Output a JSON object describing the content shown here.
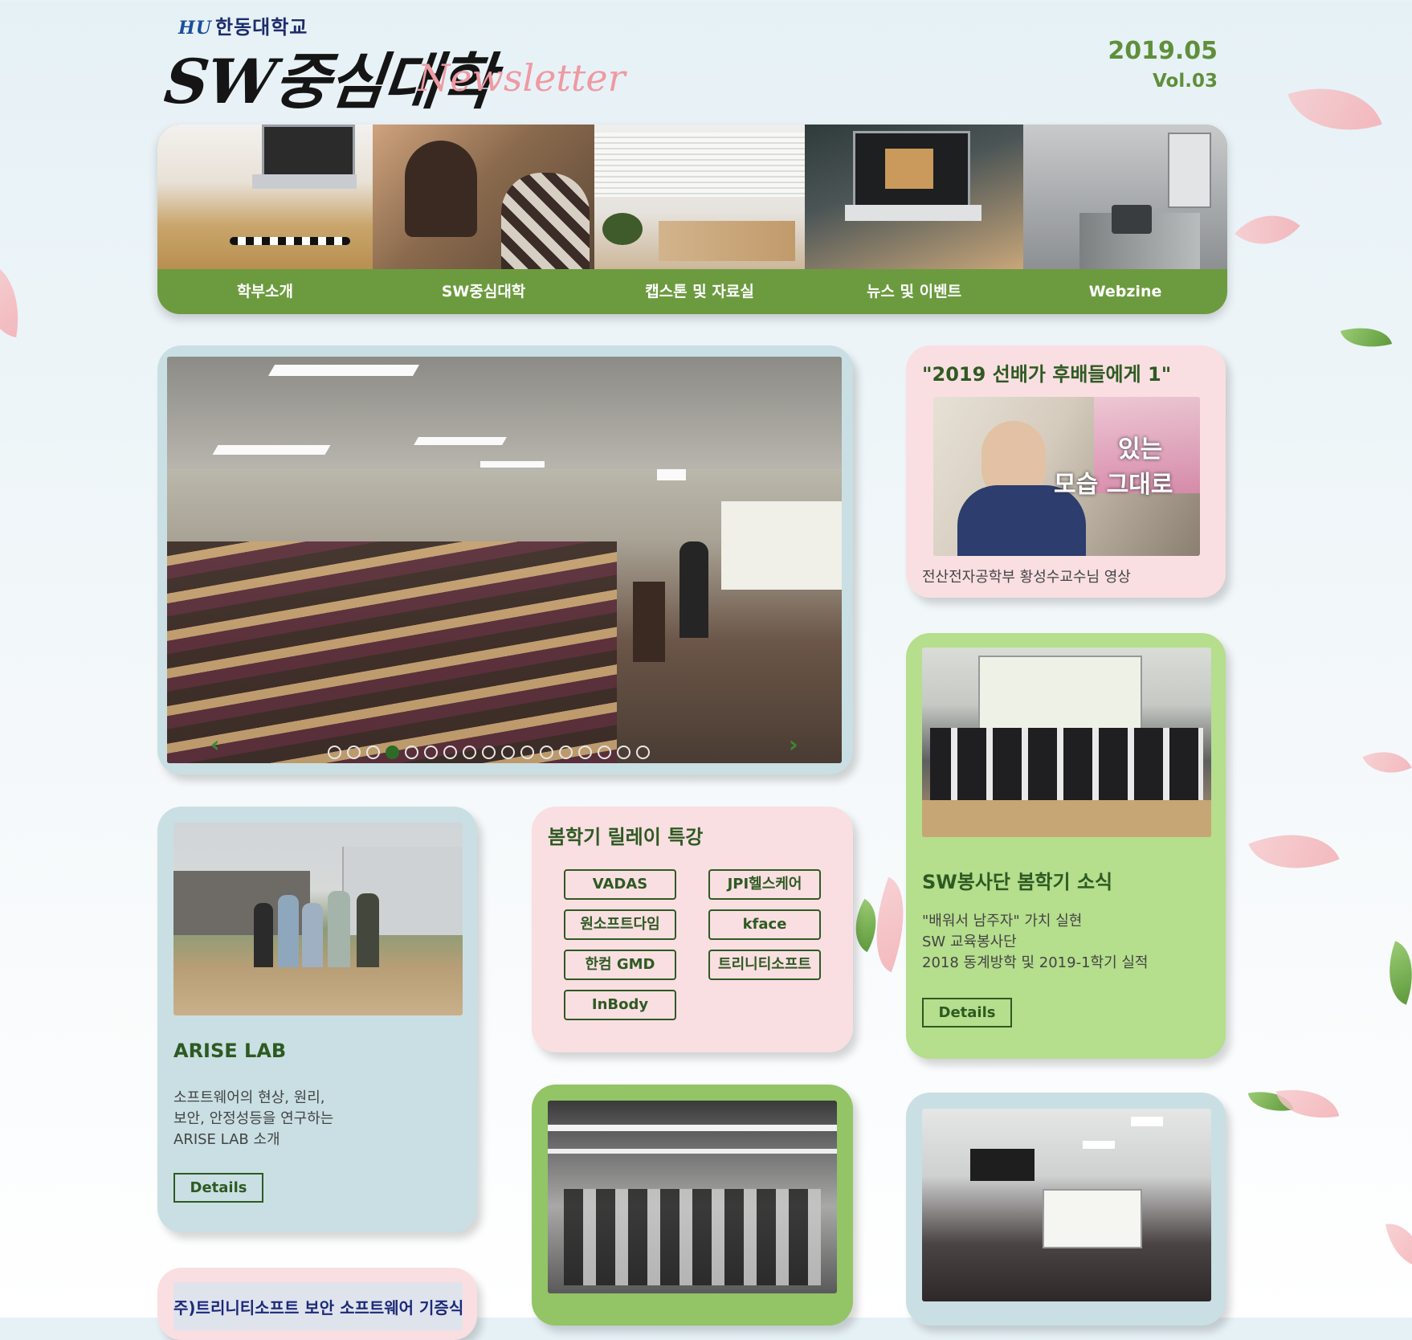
{
  "header": {
    "university": "한동대학교",
    "university_mark": "HU",
    "logo": "SW중심대학",
    "newsletter": "Newsletter",
    "date": "2019.05",
    "volume": "Vol.03"
  },
  "nav": {
    "items": [
      {
        "label": "학부소개"
      },
      {
        "label": "SW중심대학"
      },
      {
        "label": "캡스톤 및 자료실"
      },
      {
        "label": "뉴스 및 이벤트"
      },
      {
        "label": "Webzine"
      }
    ]
  },
  "slider": {
    "prev": "‹",
    "next": "›",
    "dot_count": 17,
    "active_dot": 4
  },
  "senior": {
    "title": "\"2019 선배가 후배들에게 1\"",
    "caption": "전산전자공학부 황성수교수님 영상",
    "overlay_line1": "있는",
    "overlay_line2": "모습 그대로"
  },
  "volunteer": {
    "title": "SW봉사단 봄학기 소식",
    "lines": [
      "\"배워서 남주자\" 가치 실현",
      "SW 교육봉사단",
      "2018 동계방학 및 2019-1학기 실적"
    ],
    "details": "Details"
  },
  "arise": {
    "title": "ARISE LAB",
    "lines": [
      "소프트웨어의 현상, 원리,",
      "보안, 안정성등을 연구하는",
      "ARISE LAB 소개"
    ],
    "details": "Details"
  },
  "relay": {
    "title": "봄학기 릴레이 특강",
    "items": [
      "VADAS",
      "JPI헬스케어",
      "원소프트다임",
      "kface",
      "한컴 GMD",
      "트리니티소프트",
      "InBody"
    ]
  },
  "donation": {
    "headline": "주)트리니티소프트 보안 소프트웨어 기증식"
  },
  "colors": {
    "accent_green": "#6c9b3f",
    "title_green": "#2e5a22",
    "card_blue": "#c9dfe3",
    "card_pink": "#f9dfe2",
    "card_green": "#b5de8d",
    "newsletter_pink": "#ee9aa3"
  }
}
